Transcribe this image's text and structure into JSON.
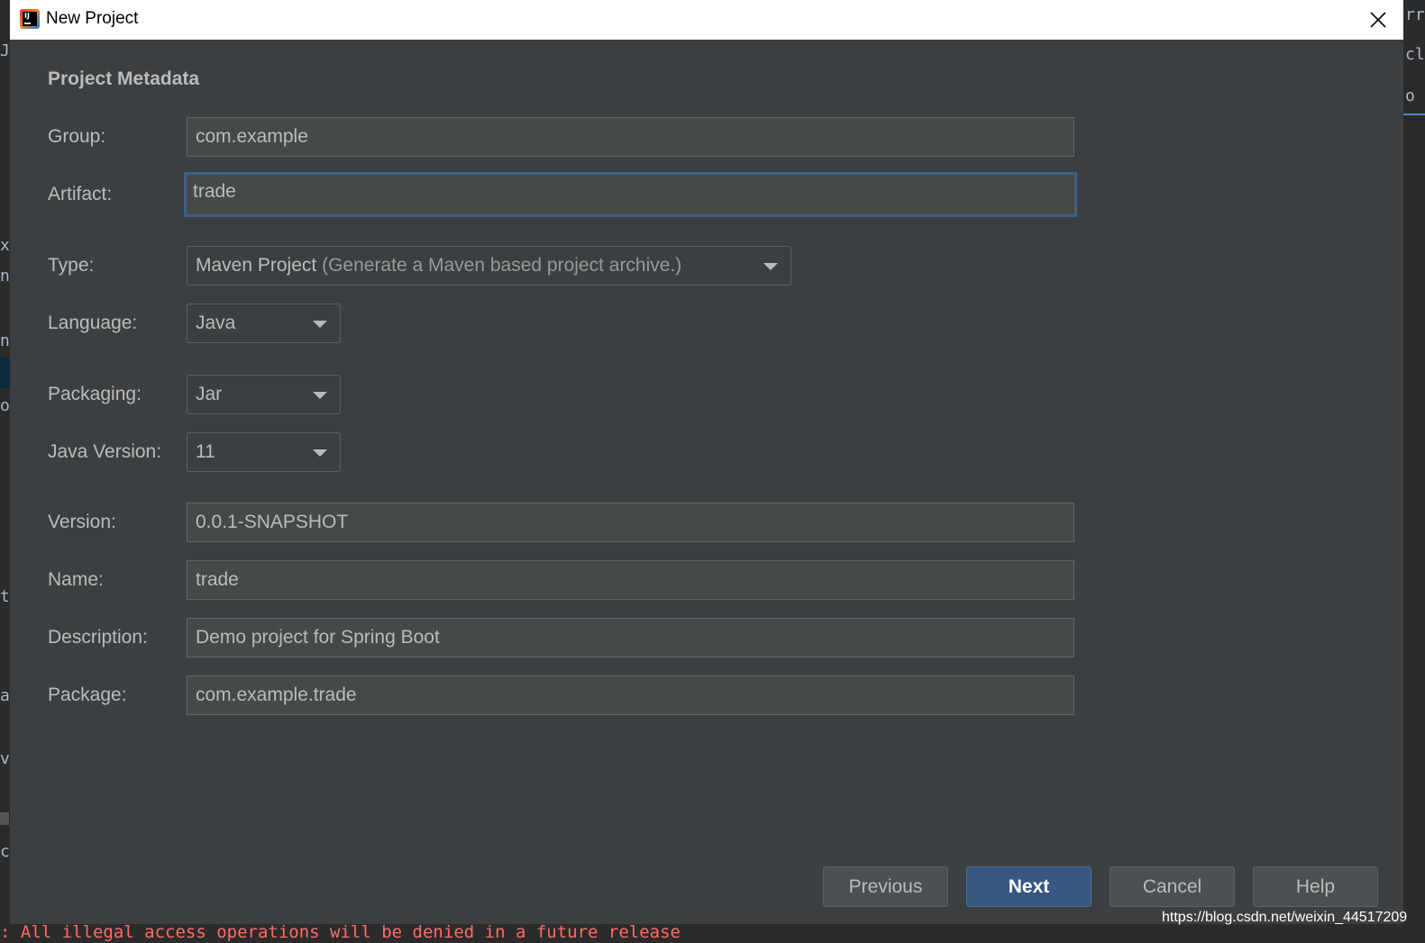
{
  "window": {
    "title": "New Project"
  },
  "section": {
    "title": "Project Metadata"
  },
  "fields": {
    "group": {
      "label": "Group:",
      "value": "com.example"
    },
    "artifact": {
      "label": "Artifact:",
      "value": "trade"
    },
    "type": {
      "label": "Type:",
      "value": "Maven Project",
      "hint": "(Generate a Maven based project archive.)"
    },
    "language": {
      "label": "Language:",
      "value": "Java"
    },
    "packaging": {
      "label": "Packaging:",
      "value": "Jar"
    },
    "java_version": {
      "label": "Java Version:",
      "value": "11"
    },
    "version": {
      "label": "Version:",
      "value": "0.0.1-SNAPSHOT"
    },
    "name": {
      "label": "Name:",
      "value": "trade"
    },
    "description": {
      "label": "Description:",
      "value": "Demo project for Spring Boot"
    },
    "package": {
      "label": "Package:",
      "value": "com.example.trade"
    }
  },
  "buttons": {
    "previous": "Previous",
    "next": "Next",
    "cancel": "Cancel",
    "help": "Help"
  },
  "console": {
    "text": ": All illegal access operations will be denied in a future release"
  },
  "watermark": "https://blog.csdn.net/weixin_44517209",
  "background": {
    "left_fragments": [
      "J",
      "x",
      "n",
      "n",
      "o",
      "ti",
      "a",
      "v",
      "c"
    ],
    "right_fragments": [
      "rr",
      "cl",
      "o"
    ]
  },
  "icons": {
    "app": "intellij-idea-icon",
    "close": "close-icon",
    "dropdown": "chevron-down-icon"
  },
  "colors": {
    "dialog_bg": "#3c3f41",
    "field_bg": "#45494a",
    "focus_border": "#3d6185",
    "primary_button": "#365880",
    "text": "#bbbbbb"
  }
}
